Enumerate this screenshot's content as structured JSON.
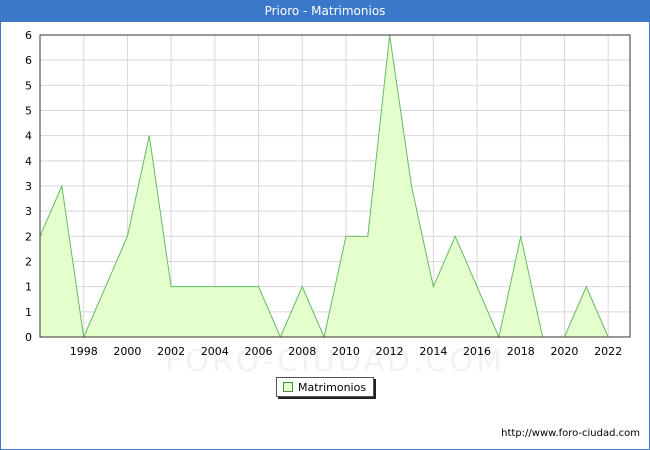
{
  "window": {
    "title": "Prioro - Matrimonios"
  },
  "chart_data": {
    "type": "area",
    "title": "Prioro - Matrimonios",
    "xlabel": "",
    "ylabel": "",
    "x": [
      1996,
      1997,
      1998,
      1999,
      2000,
      2001,
      2002,
      2003,
      2004,
      2005,
      2006,
      2007,
      2008,
      2009,
      2010,
      2011,
      2012,
      2013,
      2014,
      2015,
      2016,
      2017,
      2018,
      2019,
      2020,
      2021,
      2022
    ],
    "series": [
      {
        "name": "Matrimonios",
        "values": [
          2,
          3,
          0,
          1,
          2,
          4,
          1,
          1,
          1,
          1,
          1,
          0,
          1,
          0,
          2,
          2,
          6,
          3,
          1,
          2,
          1,
          0,
          2,
          0,
          0,
          1,
          0
        ],
        "color": "#e4ffcc",
        "line_color": "#66bb66"
      }
    ],
    "xlim": [
      1996,
      2023
    ],
    "ylim": [
      0,
      6
    ],
    "x_ticks": [
      "1998",
      "2000",
      "2002",
      "2004",
      "2006",
      "2008",
      "2010",
      "2012",
      "2014",
      "2016",
      "2018",
      "2020",
      "2022"
    ],
    "y_ticks": [
      "0",
      "1",
      "1",
      "2",
      "2",
      "3",
      "3",
      "4",
      "4",
      "5",
      "5",
      "6",
      "6"
    ],
    "grid": true,
    "legend_position": "bottom-center"
  },
  "watermark": "FORO-CIUDAD.COM",
  "footer": {
    "url": "http://www.foro-ciudad.com"
  },
  "colors": {
    "title_bar": "#3a78c9",
    "grid": "#d8d8d8",
    "fill": "#e4ffcc",
    "line": "#66bb66"
  }
}
